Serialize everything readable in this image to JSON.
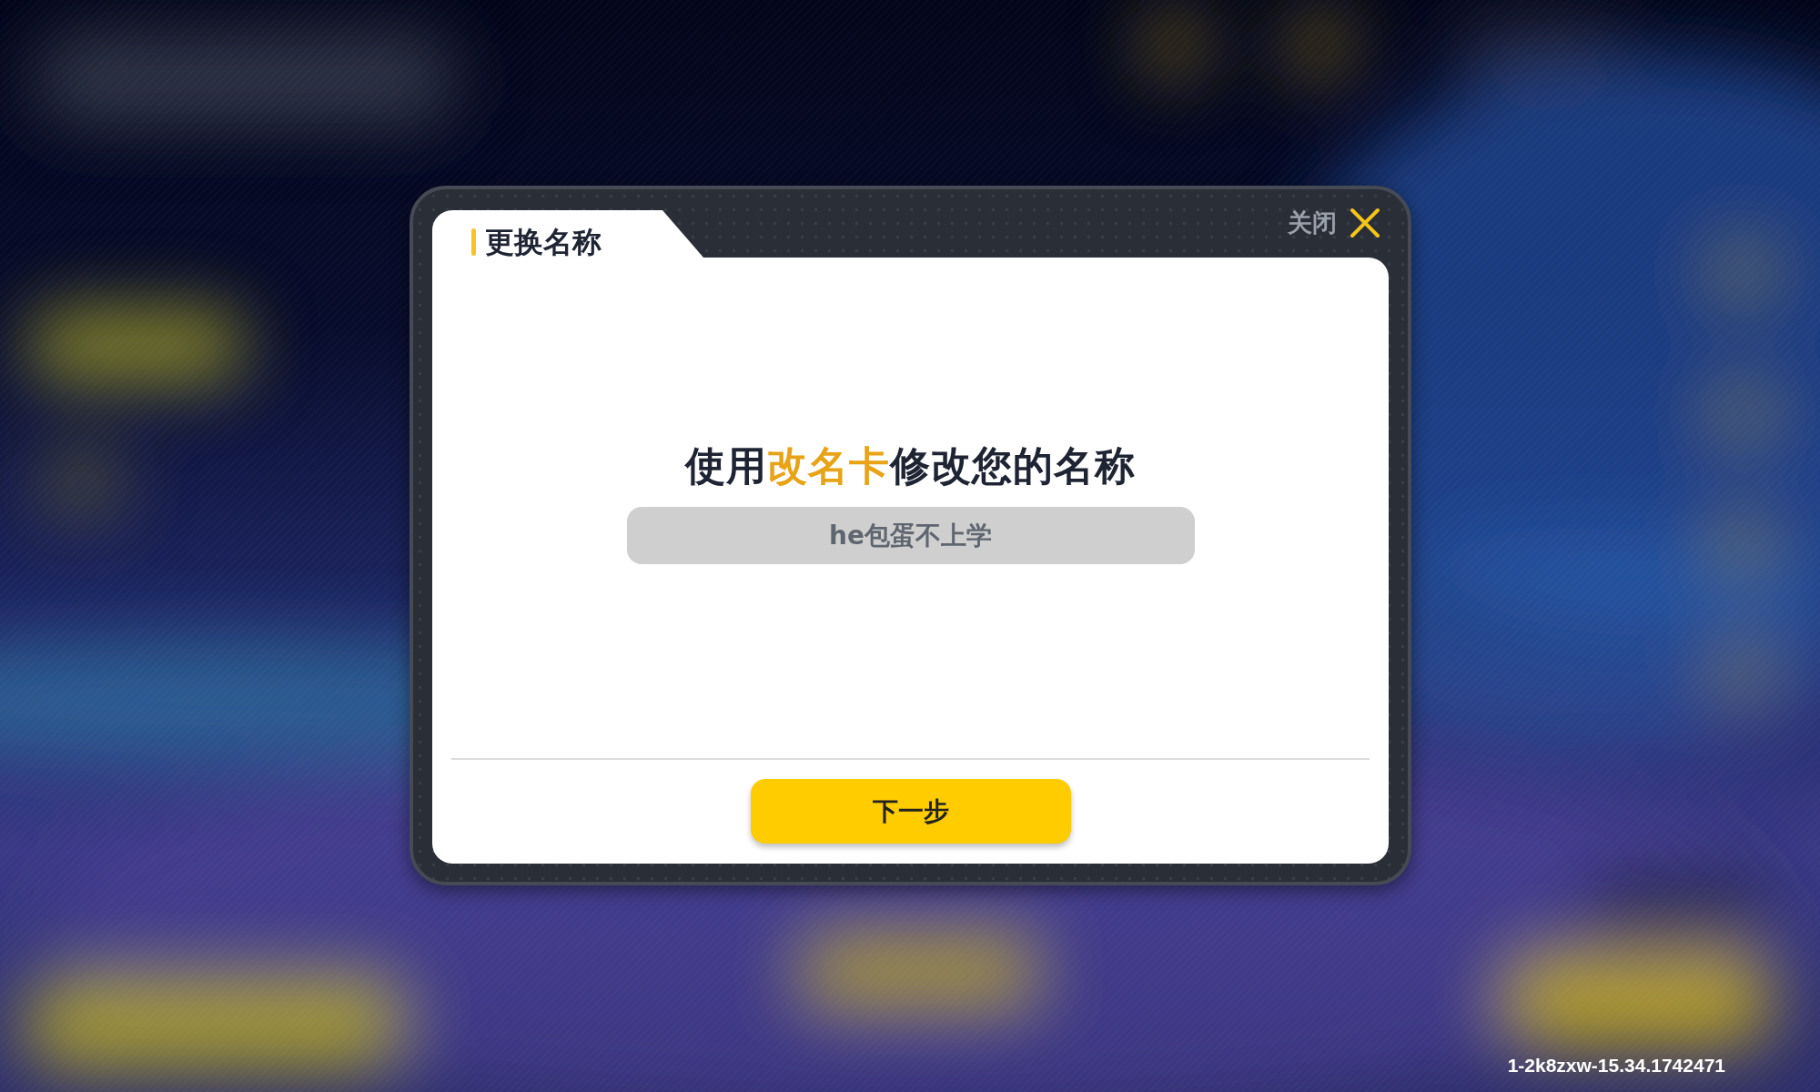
{
  "dialog": {
    "title": "更换名称",
    "close_label": "关闭",
    "prompt": [
      {
        "text": "使用",
        "highlight": false
      },
      {
        "text": "改名卡",
        "highlight": true
      },
      {
        "text": "修改您的名称",
        "highlight": false
      }
    ],
    "name_field": {
      "value": "he包蛋不上学",
      "disabled": true
    },
    "button": {
      "label": "下一步"
    }
  },
  "build_id": "1-2k8zxw-15.34.1742471"
}
